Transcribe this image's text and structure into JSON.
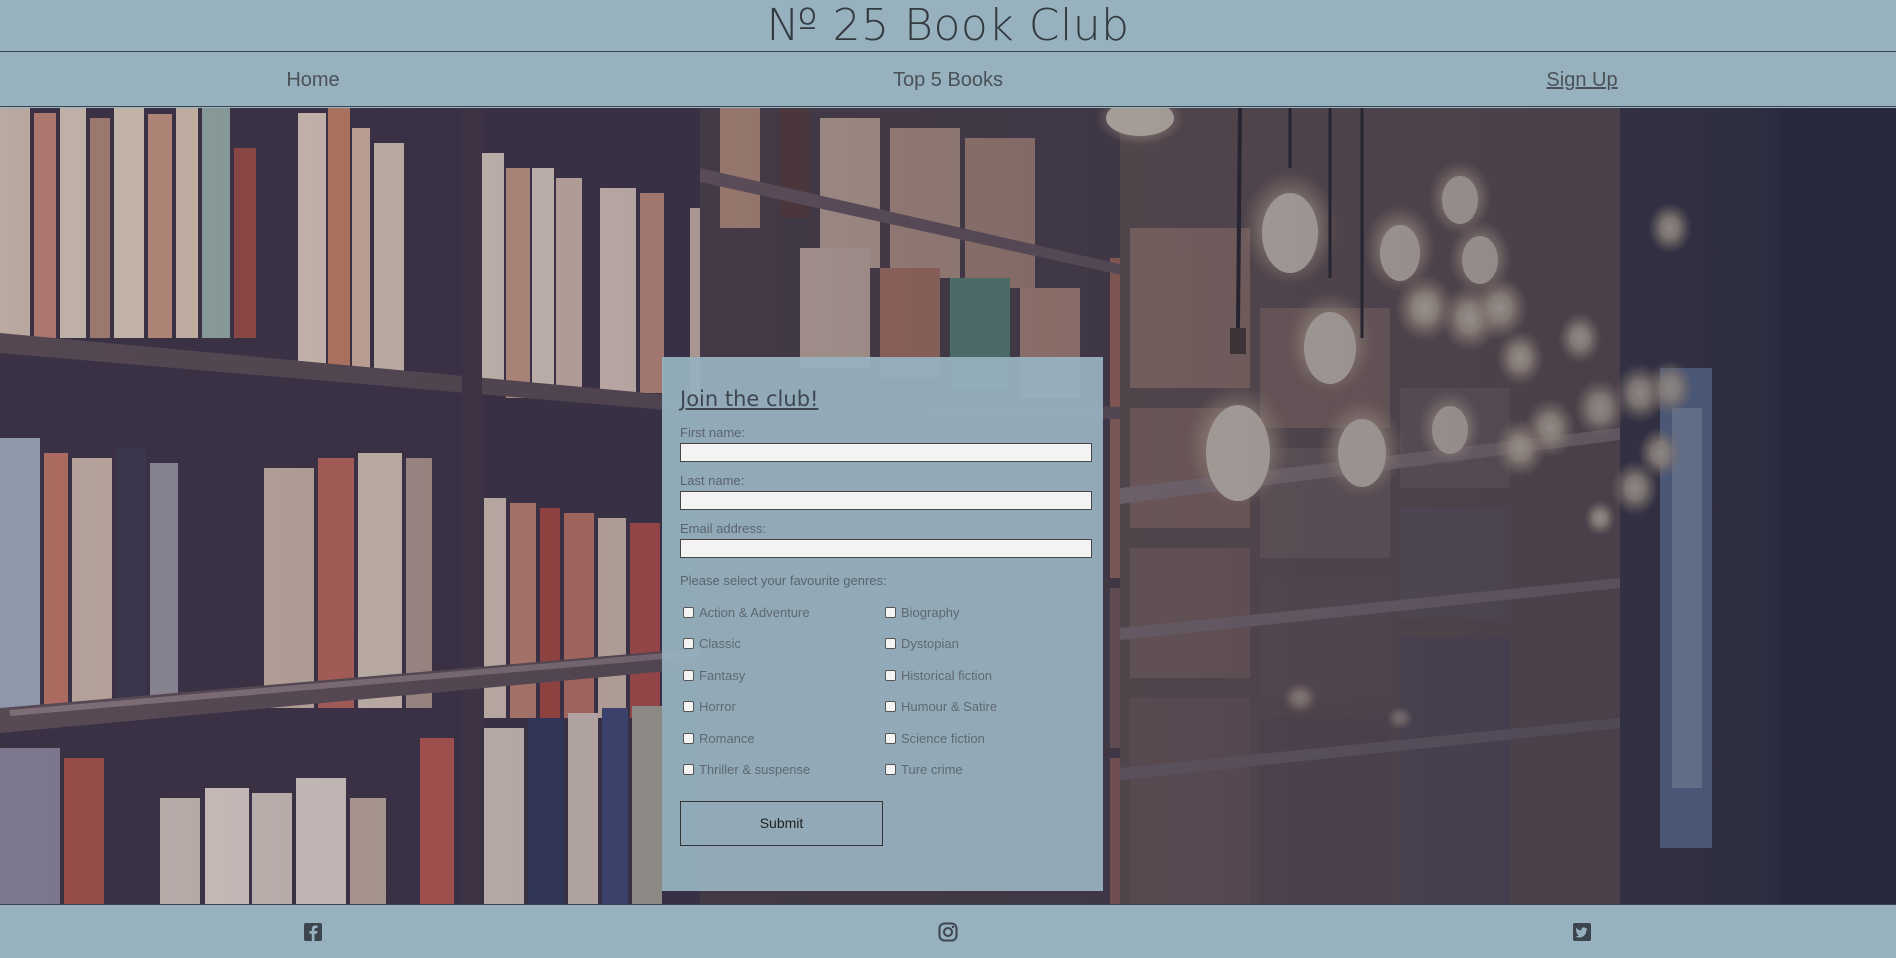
{
  "header": {
    "title": "№ 25 Book Club"
  },
  "nav": {
    "items": [
      {
        "label": "Home",
        "active": false
      },
      {
        "label": "Top 5 Books",
        "active": false
      },
      {
        "label": "Sign Up",
        "active": true
      }
    ]
  },
  "hero": {
    "background": "library-bookshelves-with-hanging-light-bulbs"
  },
  "form": {
    "title": "Join the club!",
    "fields": [
      {
        "label": "First name:",
        "value": ""
      },
      {
        "label": "Last name:",
        "value": ""
      },
      {
        "label": "Email address:",
        "value": ""
      }
    ],
    "genres_label": "Please select your favourite genres:",
    "genres": [
      "Action & Adventure",
      "Biography",
      "Classic",
      "Dystopian",
      "Fantasy",
      "Historical fiction",
      "Horror",
      "Humour & Satire",
      "Romance",
      "Science fiction",
      "Thriller & suspense",
      "Ture crime"
    ],
    "submit_label": "Submit"
  },
  "footer": {
    "icons": [
      "facebook-icon",
      "instagram-icon",
      "twitter-icon"
    ]
  },
  "colors": {
    "bar": "#97b1bf",
    "text": "#3a3a3a"
  }
}
